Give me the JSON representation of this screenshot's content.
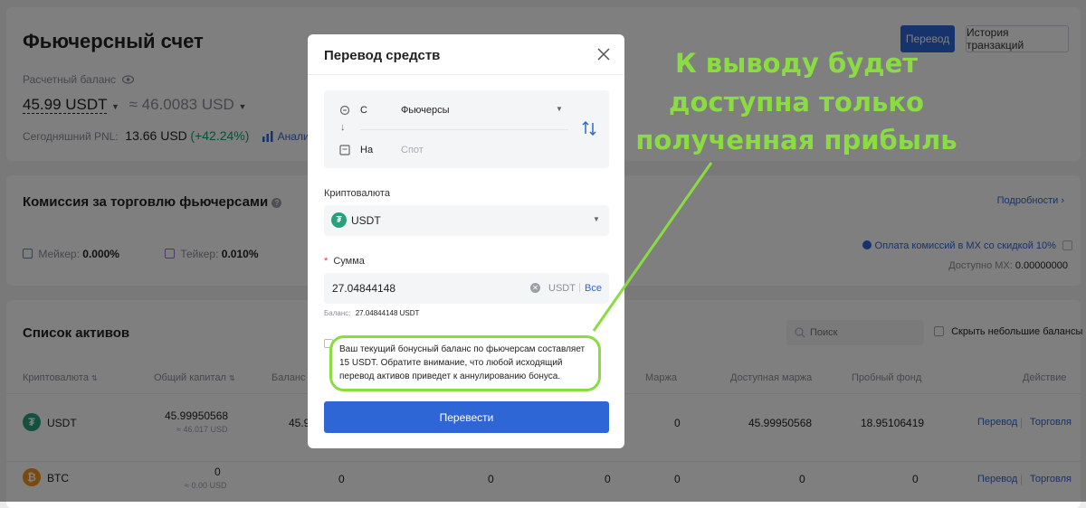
{
  "header": {
    "title": "Фьючерсный счет",
    "transfer_btn": "Перевод",
    "history_btn": "История транзакций",
    "balance_label": "Расчетный баланс",
    "balance_usdt": "45.99 USDT",
    "balance_usd": "≈ 46.0083 USD",
    "pnl_label": "Сегодняшний PNL:",
    "pnl_value": "13.66 USD",
    "pnl_percent": "(+42.24%)",
    "analysis_link": "Анализ"
  },
  "commission": {
    "title": "Комиссия за торговлю фьючерсами",
    "details_link": "Подробности",
    "maker_label": "Мейкер:",
    "maker_value": "0.000%",
    "taker_label": "Тейкер:",
    "taker_value": "0.010%",
    "mx_discount": "Оплата комиссий в MX со скидкой 10%",
    "mx_available_label": "Доступно MX:",
    "mx_available_value": "0.00000000"
  },
  "assets": {
    "title": "Список активов",
    "search_placeholder": "Поиск",
    "hide_small_label": "Скрыть небольшие балансы",
    "columns": {
      "crypto": "Криптовалюта",
      "total_capital": "Общий капитал",
      "balance": "Баланс ко",
      "margin": "Маржа",
      "available_margin": "Доступная маржа",
      "trial_fund": "Пробный фонд",
      "action": "Действие"
    },
    "rows": [
      {
        "coin": "USDT",
        "total": "45.99950568",
        "total_usd": "≈ 46.017 USD",
        "balance": "45.9",
        "margin": "0",
        "available": "45.99950568",
        "trial": "18.95106419",
        "action1": "Перевод",
        "action2": "Торговля"
      },
      {
        "coin": "BTC",
        "total": "0",
        "total_usd": "≈ 0.00 USD",
        "balance": "0",
        "col4": "0",
        "col5": "0",
        "margin": "0",
        "available": "0",
        "trial": "0",
        "action1": "Перевод",
        "action2": "Торговля"
      }
    ]
  },
  "modal": {
    "title": "Перевод средств",
    "from_label": "С",
    "from_value": "Фьючерсы",
    "to_label": "На",
    "to_value": "Спот",
    "crypto_label": "Криптовалюта",
    "crypto_value": "USDT",
    "amount_required": "*",
    "amount_label": "Сумма",
    "amount_value": "27.04844148",
    "amount_unit": "USDT",
    "amount_all": "Все",
    "balance_label": "Баланс:",
    "balance_value": "27.04844148 USDT",
    "bonus_notice": "Ваш текущий бонусный баланс по фьючерсам составляет 15 USDT. Обратите внимание, что любой исходящий перевод активов приведет к аннулированию бонуса.",
    "submit_label": "Перевести"
  },
  "annotation": {
    "line1": "К выводу будет",
    "line2": "доступна только",
    "line3": "полученная прибыль",
    "color": "#8bdb43"
  },
  "colors": {
    "primary": "#2f66d6",
    "positive": "#12a36a",
    "usdt": "#26a17b",
    "btc": "#f7931a"
  }
}
